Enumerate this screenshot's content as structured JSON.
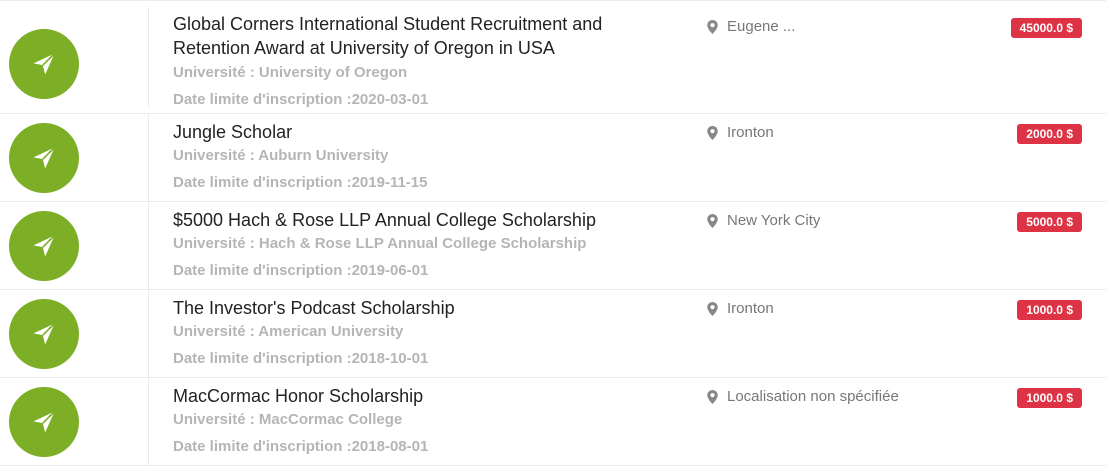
{
  "scholarships": [
    {
      "title": "Global Corners International Student Recruitment and Retention Award at University of Oregon in USA",
      "university": "Université : University of Oregon",
      "deadline": "Date limite d'inscription :2020-03-01",
      "location": "Eugene ...",
      "amount": "45000.0 $"
    },
    {
      "title": "Jungle Scholar",
      "university": "Université : Auburn University",
      "deadline": "Date limite d'inscription :2019-11-15",
      "location": "Ironton",
      "amount": "2000.0 $"
    },
    {
      "title": "$5000 Hach & Rose LLP Annual College Scholarship",
      "university": "Université : Hach & Rose LLP Annual College Scholarship",
      "deadline": "Date limite d'inscription :2019-06-01",
      "location": "New York City",
      "amount": "5000.0 $"
    },
    {
      "title": "The Investor's Podcast Scholarship",
      "university": "Université : American University",
      "deadline": "Date limite d'inscription :2018-10-01",
      "location": "Ironton",
      "amount": "1000.0 $"
    },
    {
      "title": "MacCormac Honor Scholarship",
      "university": "Université : MacCormac College",
      "deadline": "Date limite d'inscription :2018-08-01",
      "location": "Localisation non spécifiée",
      "amount": "1000.0 $"
    }
  ],
  "colors": {
    "icon_bg": "#7cae26",
    "badge_bg": "#dd3344"
  },
  "icons": {
    "row_icon": "paper-plane-icon",
    "location_icon": "map-pin-icon"
  }
}
